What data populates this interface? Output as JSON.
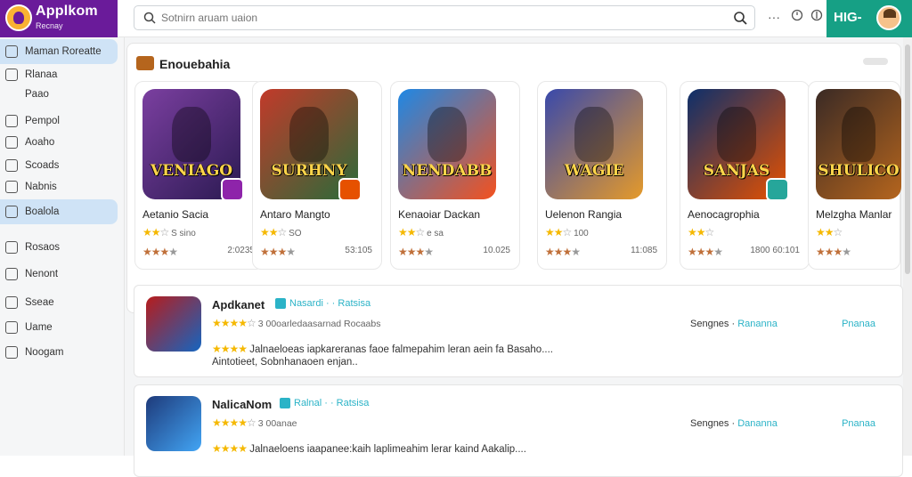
{
  "app": {
    "title": "Applkom",
    "subtitle": "Recnay"
  },
  "search": {
    "placeholder": "Sotnirn aruam uaion"
  },
  "header": {
    "greeting": "HIG-"
  },
  "sidebar": {
    "items": [
      {
        "label": "Maman Roreatte",
        "icon": "home-icon",
        "active": true
      },
      {
        "label": "Rlanaa",
        "icon": "grid-icon"
      },
      {
        "label": "Paao",
        "icon": ""
      },
      {
        "label": "Pempol",
        "icon": "gamepad-icon"
      },
      {
        "label": "Aoaho",
        "icon": "list-icon"
      },
      {
        "label": "Scoads",
        "icon": "calendar-icon"
      },
      {
        "label": "Nabnis",
        "icon": "book-icon"
      },
      {
        "label": "Boalola",
        "icon": "puzzle-icon",
        "active": true
      },
      {
        "label": "Rosaos",
        "icon": "tag-icon"
      },
      {
        "label": "Nenont",
        "icon": "box-icon"
      },
      {
        "label": "Sseae",
        "icon": "user-icon"
      },
      {
        "label": "Uame",
        "icon": "mail-icon"
      },
      {
        "label": "Noogam",
        "icon": "image-icon"
      }
    ]
  },
  "featured": {
    "heading": "Enouebahia",
    "cards": [
      {
        "art_title": "VENIAGO",
        "name": "Aetanio Sacia",
        "meta": "S sino",
        "count": "2:0235",
        "colors": [
          "#7b3fa0",
          "#2b1a52"
        ],
        "badge": "#8e24aa"
      },
      {
        "art_title": "SURHNY",
        "name": "Antaro Mangto",
        "meta": "SO",
        "count": "53:105",
        "colors": [
          "#c23a2a",
          "#2a6b3a"
        ],
        "badge": "#e65100"
      },
      {
        "art_title": "NENDABB",
        "name": "Kenaoiar Dackan",
        "meta": "e sa",
        "count": "10.025",
        "colors": [
          "#1e88e5",
          "#f4511e"
        ],
        "badge": ""
      },
      {
        "art_title": "WAGIE",
        "name": "Uelenon Rangia",
        "meta": "100",
        "count": "11:085",
        "colors": [
          "#3949ab",
          "#e59a2a"
        ],
        "badge": ""
      },
      {
        "art_title": "SANJAS",
        "name": "Aenocagrophia",
        "meta": "",
        "count": "1800  60:101",
        "colors": [
          "#0d2f6b",
          "#e65100"
        ],
        "badge": "#26a69a"
      },
      {
        "art_title": "SHULICO",
        "name": "Melzgha Manlar",
        "meta": "",
        "count": "",
        "colors": [
          "#3a2a25",
          "#b5651d"
        ],
        "badge": ""
      }
    ]
  },
  "list": [
    {
      "name": "Apdkanet",
      "developer": "Nasardi · · Ratsisa",
      "meta": "3 00oarledaasarnad Rocaabs",
      "line1": "Jalnaeloeas iapkareranas  faoe falmepahim  leran aein fa Basaho....",
      "line2": "Aintotieet, Sobnhanaoen enjan..",
      "category": "Sengnes",
      "category2": "Rananna",
      "price": "Pnanaa",
      "thumb": [
        "#b71c1c",
        "#1565c0"
      ]
    },
    {
      "name": "NalicaNom",
      "developer": "Ralnal · · Ratsisa",
      "meta": "3 00anae",
      "line1": "Jalnaeloens iaapanee:kaih  laplimeahim  lerar kaind Aakalip....",
      "line2": "",
      "category": "Sengnes",
      "category2": "Dananna",
      "price": "Pnanaa",
      "thumb": [
        "#1e3a7a",
        "#42a5f5"
      ]
    }
  ],
  "colors": {
    "brand": "#6a1b9a",
    "accent": "#16a085",
    "link": "#2bb3c7"
  }
}
